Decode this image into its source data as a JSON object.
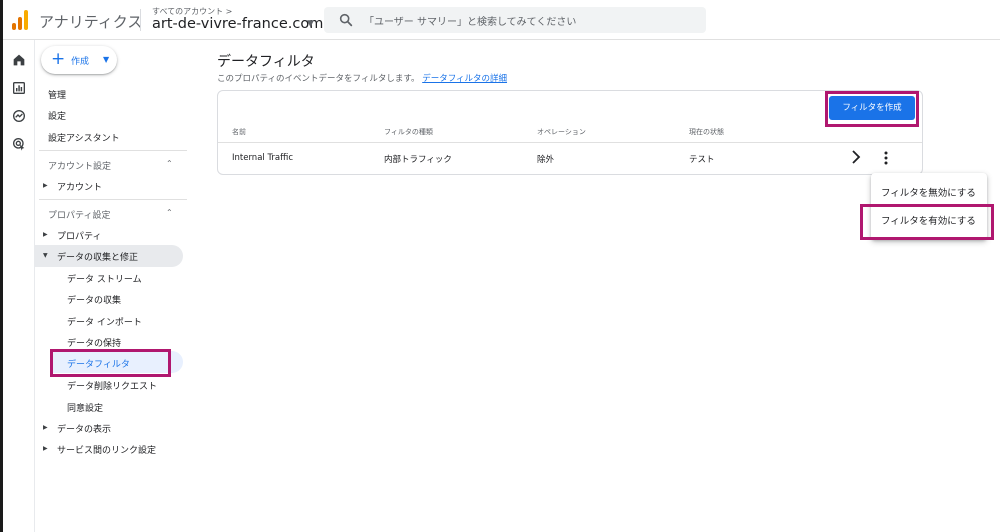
{
  "header": {
    "app_name": "アナリティクス",
    "breadcrumb": "すべてのアカウント >",
    "account_name": "art-de-vivre-france.com",
    "search_placeholder": "「ユーザー サマリー」と検索してみてください",
    "logo_colors": [
      "#F9AB00",
      "#E37400",
      "#E37400"
    ]
  },
  "rail": {
    "icons": [
      "home-icon",
      "reports-icon",
      "explore-icon",
      "advertising-icon"
    ]
  },
  "sidebar": {
    "create_label": "作成",
    "items": {
      "admin": "管理",
      "settings": "設定",
      "setup_assistant": "設定アシスタント",
      "account_settings": "アカウント設定",
      "account": "アカウント",
      "property_settings": "プロパティ設定",
      "property": "プロパティ",
      "data_collection": "データの収集と修正",
      "data_streams": "データ ストリーム",
      "data_collection_sub": "データの収集",
      "data_import": "データ インポート",
      "data_retention": "データの保持",
      "data_filters": "データフィルタ",
      "data_deletion": "データ削除リクエスト",
      "consent": "同意設定",
      "data_display": "データの表示",
      "product_links": "サービス間のリンク設定"
    }
  },
  "main": {
    "title": "データフィルタ",
    "description": "このプロパティのイベントデータをフィルタします。",
    "description_link": "データフィルタの詳細",
    "create_button": "フィルタを作成",
    "columns": [
      "名前",
      "フィルタの種類",
      "オペレーション",
      "現在の状態"
    ],
    "rows": [
      {
        "name": "Internal Traffic",
        "type": "内部トラフィック",
        "operation": "除外",
        "state": "テスト"
      }
    ]
  },
  "menu": {
    "items": [
      "フィルタを無効にする",
      "フィルタを有効にする"
    ]
  },
  "colors": {
    "accent": "#1a73e8",
    "highlight": "#b0176f"
  }
}
